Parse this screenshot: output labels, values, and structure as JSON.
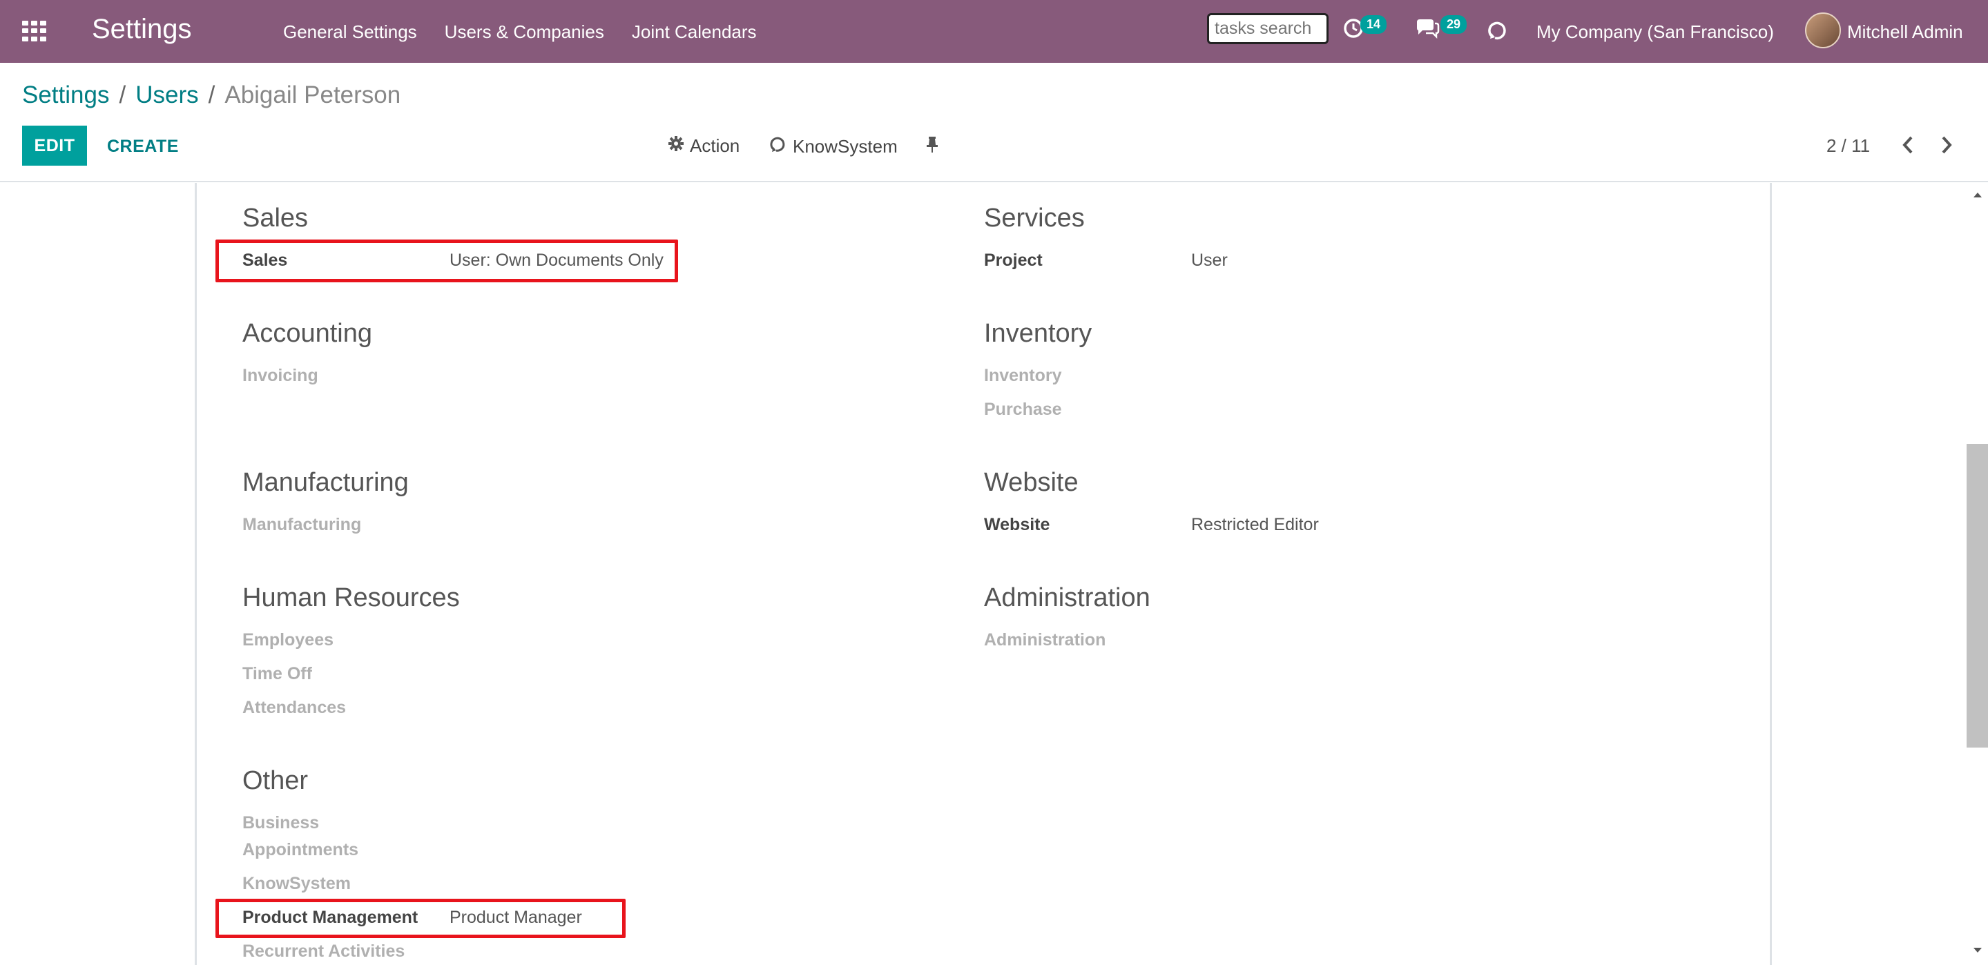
{
  "navbar": {
    "brand": "Settings",
    "menu": [
      "General Settings",
      "Users & Companies",
      "Joint Calendars"
    ],
    "search_placeholder": "tasks search",
    "activity_count": "14",
    "message_count": "29",
    "company": "My Company (San Francisco)",
    "user": "Mitchell Admin"
  },
  "control_panel": {
    "breadcrumb": [
      "Settings",
      "Users",
      "Abigail Peterson"
    ],
    "separator": "/",
    "edit_label": "EDIT",
    "create_label": "CREATE",
    "action_label": "Action",
    "knowsystem_label": "KnowSystem",
    "pager": "2 / 11"
  },
  "sections": {
    "sales": {
      "title": "Sales",
      "fields": [
        {
          "label": "Sales",
          "value": "User: Own Documents Only"
        }
      ]
    },
    "services": {
      "title": "Services",
      "fields": [
        {
          "label": "Project",
          "value": "User"
        }
      ]
    },
    "accounting": {
      "title": "Accounting",
      "fields": [
        {
          "label": "Invoicing",
          "value": ""
        }
      ]
    },
    "inventory": {
      "title": "Inventory",
      "fields": [
        {
          "label": "Inventory",
          "value": ""
        },
        {
          "label": "Purchase",
          "value": ""
        }
      ]
    },
    "manufacturing": {
      "title": "Manufacturing",
      "fields": [
        {
          "label": "Manufacturing",
          "value": ""
        }
      ]
    },
    "website": {
      "title": "Website",
      "fields": [
        {
          "label": "Website",
          "value": "Restricted Editor"
        }
      ]
    },
    "human_resources": {
      "title": "Human Resources",
      "fields": [
        {
          "label": "Employees",
          "value": ""
        },
        {
          "label": "Time Off",
          "value": ""
        },
        {
          "label": "Attendances",
          "value": ""
        }
      ]
    },
    "administration": {
      "title": "Administration",
      "fields": [
        {
          "label": "Administration",
          "value": ""
        }
      ]
    },
    "other": {
      "title": "Other",
      "fields": [
        {
          "label": "Business",
          "value": ""
        },
        {
          "label": "Appointments",
          "value": ""
        },
        {
          "label": "KnowSystem",
          "value": ""
        },
        {
          "label": "Product Management",
          "value": "Product Manager"
        },
        {
          "label": "Recurrent Activities",
          "value": ""
        }
      ]
    }
  },
  "colors": {
    "navbar": "#875a7b",
    "accent": "#00a09d",
    "link": "#017e84",
    "highlight": "#e8141c"
  }
}
